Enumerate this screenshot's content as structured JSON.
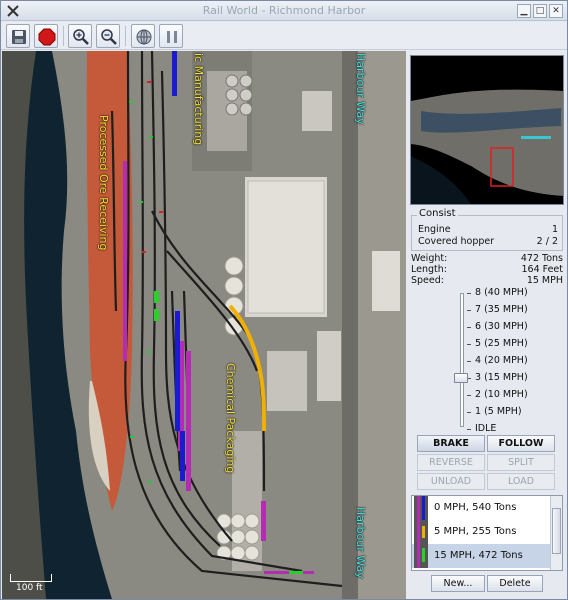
{
  "window": {
    "title": "Rail World - Richmond Harbor",
    "controls": [
      "minimize-icon",
      "maximize-icon",
      "close-icon"
    ]
  },
  "toolbar": {
    "buttons": [
      {
        "name": "save",
        "icon": "floppy-disk-icon"
      },
      {
        "name": "stop",
        "icon": "stop-sign-icon"
      },
      {
        "name": "zoom-in",
        "icon": "zoom-in-icon"
      },
      {
        "name": "zoom-out",
        "icon": "zoom-out-icon"
      },
      {
        "name": "globe",
        "icon": "globe-icon"
      },
      {
        "name": "pause",
        "icon": "pause-icon"
      }
    ]
  },
  "map": {
    "labels": {
      "processed_ore": "Processed Ore Receiving",
      "manufacturing": "ic Manufacturing",
      "chemical": "Chemical Packaging",
      "harbour_top": "Harbour Way",
      "harbour_bottom": "Harbour Way"
    },
    "scale_label": "100 ft"
  },
  "consist": {
    "legend": "Consist",
    "rows": [
      {
        "label": "Engine",
        "value": "1"
      },
      {
        "label": "Covered hopper",
        "value": "2 / 2"
      }
    ]
  },
  "stats": {
    "weight_label": "Weight:",
    "weight": "472 Tons",
    "length_label": "Length:",
    "length": "164 Feet",
    "speed_label": "Speed:",
    "speed": "15 MPH"
  },
  "throttle": {
    "notches": [
      "8 (40 MPH)",
      "7 (35 MPH)",
      "6 (30 MPH)",
      "5 (25 MPH)",
      "4 (20 MPH)",
      "3 (15 MPH)",
      "2 (10 MPH)",
      "1 (5 MPH)",
      "IDLE"
    ],
    "selected": "3 (15 MPH)"
  },
  "controls": {
    "brake": "BRAKE",
    "follow": "FOLLOW",
    "reverse": "REVERSE",
    "split": "SPLIT",
    "unload": "UNLOAD",
    "load": "LOAD"
  },
  "trains": [
    {
      "label": "0 MPH, 540 Tons"
    },
    {
      "label": "5 MPH, 255 Tons"
    },
    {
      "label": "15 MPH, 472 Tons",
      "selected": true
    }
  ],
  "footer": {
    "new": "New...",
    "delete": "Delete"
  }
}
